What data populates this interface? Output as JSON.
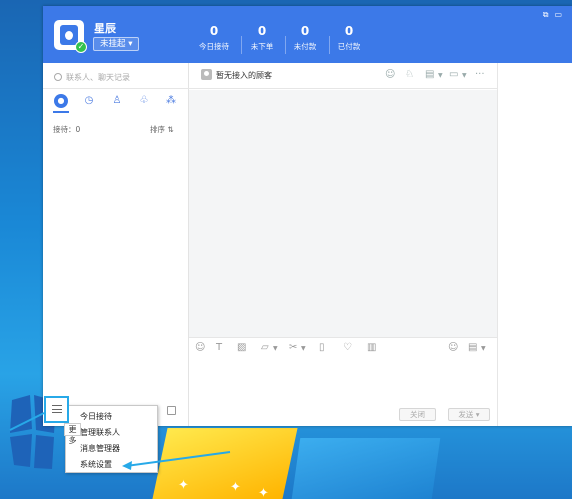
{
  "header": {
    "name": "星辰",
    "status": "未挂起 ▾",
    "stats": [
      {
        "value": "0",
        "label": "今日接待"
      },
      {
        "value": "0",
        "label": "未下单"
      },
      {
        "value": "0",
        "label": "未付款"
      },
      {
        "value": "0",
        "label": "已付款"
      }
    ]
  },
  "left_panel": {
    "search_placeholder": "联系人、聊天记录",
    "reception": "接待：0",
    "sort": "排序 ⇅"
  },
  "chat": {
    "visitor_title": "暂无接入的顾客",
    "close_label": "关闭",
    "send_label": "发送 ▾"
  },
  "menu": {
    "more_label": "更多",
    "items": [
      "今日接待",
      "管理联系人",
      "消息管理器",
      "系统设置"
    ]
  },
  "colors": {
    "header": "#3c79e8",
    "highlight": "#27a9e8"
  }
}
